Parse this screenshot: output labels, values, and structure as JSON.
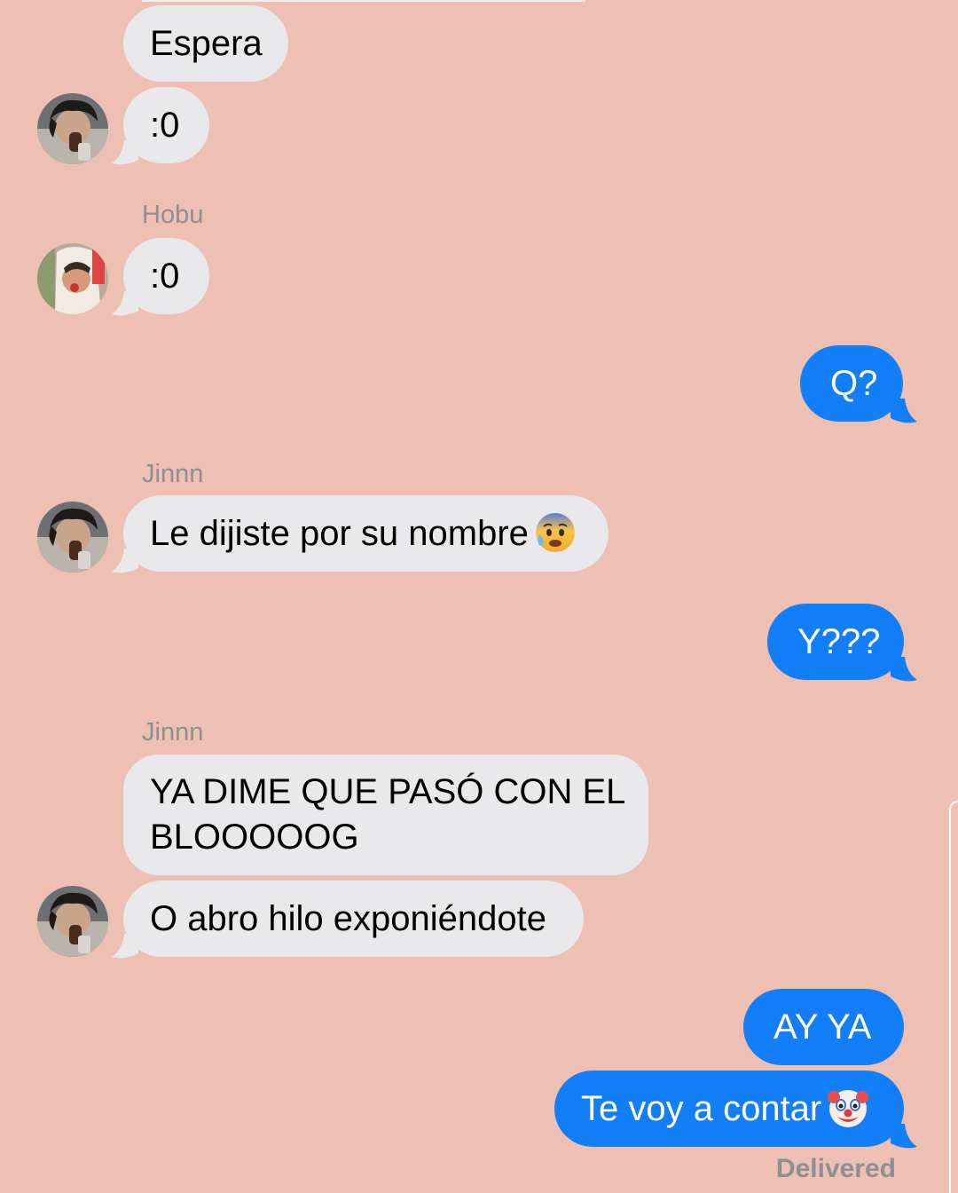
{
  "messages": [
    {
      "side": "in",
      "text": "Espera"
    },
    {
      "side": "in",
      "text": ":0"
    },
    {
      "side": "in",
      "sender": "Hobu",
      "text": ":0"
    },
    {
      "side": "out",
      "text": "Q?"
    },
    {
      "side": "in",
      "sender": "Jinnn",
      "text": "Le dijiste por su nombre",
      "emoji": "anxious-face-with-sweat"
    },
    {
      "side": "out",
      "text": "Y???"
    },
    {
      "side": "in",
      "sender": "Jinnn",
      "text_line1": "YA DIME QUE PASÓ CON EL",
      "text_line2": "BLOOOOOG"
    },
    {
      "side": "in",
      "text": "O abro hilo exponiéndote"
    },
    {
      "side": "out",
      "text": "AY YA"
    },
    {
      "side": "out",
      "text": "Te voy a contar",
      "emoji": "clown-face"
    }
  ],
  "status": "Delivered",
  "colors": {
    "background": "#eebfb3",
    "incoming_bubble": "#e9e9eb",
    "outgoing_bubble": "#127ef8",
    "meta_text": "#8e8e93"
  }
}
